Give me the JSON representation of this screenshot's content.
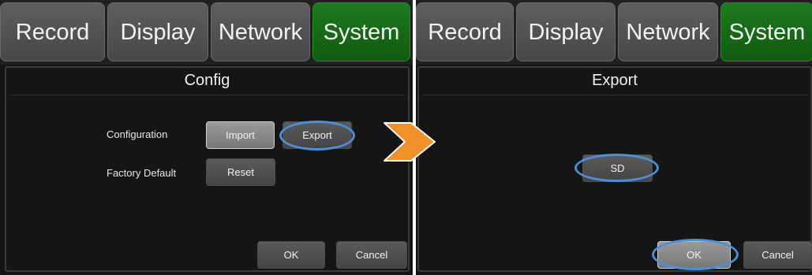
{
  "left": {
    "tabs": [
      {
        "label": "Record",
        "active": false
      },
      {
        "label": "Display",
        "active": false
      },
      {
        "label": "Network",
        "active": false
      },
      {
        "label": "System",
        "active": true
      }
    ],
    "title": "Config",
    "rows": {
      "configuration_label": "Configuration",
      "import_label": "Import",
      "export_label": "Export",
      "factory_default_label": "Factory Default",
      "reset_label": "Reset"
    },
    "footer": {
      "ok_label": "OK",
      "cancel_label": "Cancel"
    }
  },
  "right": {
    "tabs": [
      {
        "label": "Record",
        "active": false
      },
      {
        "label": "Display",
        "active": false
      },
      {
        "label": "Network",
        "active": false
      },
      {
        "label": "System",
        "active": true
      }
    ],
    "title": "Export",
    "sd_label": "SD",
    "footer": {
      "ok_label": "OK",
      "cancel_label": "Cancel"
    }
  },
  "colors": {
    "active_tab": "#0f6a0f",
    "highlight_ring": "#4a90d9",
    "arrow": "#f0902a"
  },
  "icons": {
    "transition_arrow": "right-arrow-icon"
  }
}
